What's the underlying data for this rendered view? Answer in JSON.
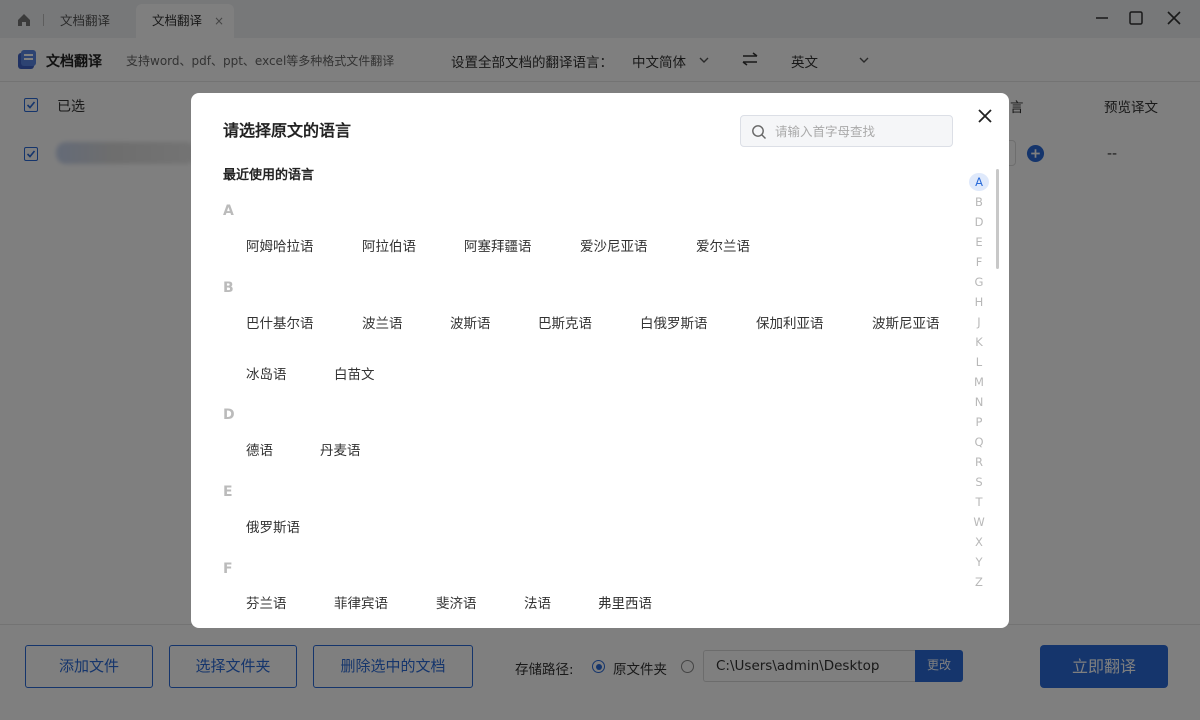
{
  "titlebar": {
    "tabs": [
      {
        "label": "文档翻译"
      },
      {
        "label": "文档翻译",
        "close": "×"
      }
    ]
  },
  "toolbar": {
    "app_title": "文档翻译",
    "app_subtitle": "支持word、pdf、ppt、excel等多种格式文件翻译",
    "lang_label": "设置全部文档的翻译语言：",
    "source_lang": "中文简体",
    "target_lang": "英文"
  },
  "table": {
    "selected_label": "已选",
    "col_lang": "言",
    "col_preview": "预览译文",
    "row_preview": "--"
  },
  "bottom": {
    "add_file": "添加文件",
    "select_folder": "选择文件夹",
    "delete_selected": "删除选中的文档",
    "store_label": "存储路径:",
    "radio_original": "原文件夹",
    "path": "C:\\Users\\admin\\Desktop",
    "change": "更改",
    "translate": "立即翻译"
  },
  "dialog": {
    "title": "请选择原文的语言",
    "search_placeholder": "请输入首字母查找",
    "recent_label": "最近使用的语言",
    "groups": [
      {
        "letter": "A",
        "items": [
          "阿姆哈拉语",
          "阿拉伯语",
          "阿塞拜疆语",
          "爱沙尼亚语",
          "爱尔兰语"
        ]
      },
      {
        "letter": "B",
        "items": [
          "巴什基尔语",
          "波兰语",
          "波斯语",
          "巴斯克语",
          "白俄罗斯语",
          "保加利亚语",
          "波斯尼亚语",
          "冰岛语",
          "白苗文"
        ]
      },
      {
        "letter": "D",
        "items": [
          "德语",
          "丹麦语"
        ]
      },
      {
        "letter": "E",
        "items": [
          "俄罗斯语"
        ]
      },
      {
        "letter": "F",
        "items": [
          "芬兰语",
          "菲律宾语",
          "斐济语",
          "法语",
          "弗里西语"
        ]
      }
    ],
    "alphabet": [
      "A",
      "B",
      "D",
      "E",
      "F",
      "G",
      "H",
      "J",
      "K",
      "L",
      "M",
      "N",
      "P",
      "Q",
      "R",
      "S",
      "T",
      "W",
      "X",
      "Y",
      "Z"
    ],
    "active_letter": "A"
  },
  "colors": {
    "accent": "#2a6bd9",
    "overlay": "rgba(0,0,0,0.5)"
  }
}
